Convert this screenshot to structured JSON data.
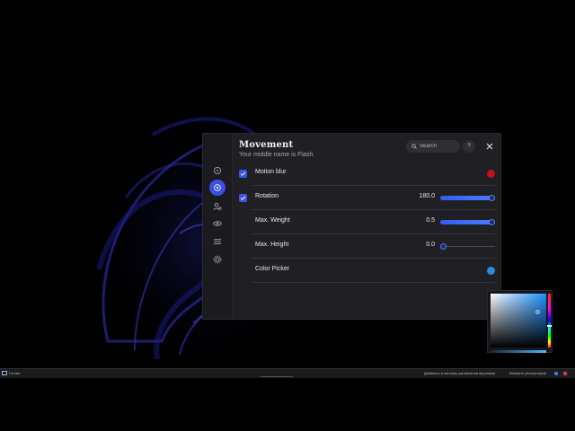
{
  "panel": {
    "title": "Movement",
    "subtitle": "Your middle name is Flash.",
    "search_placeholder": "Search",
    "help_label": "?",
    "rail_icons": [
      "target-icon",
      "movement-icon",
      "user-settings-icon",
      "eye-icon",
      "list-icon",
      "gear-icon"
    ],
    "active_rail_index": 1
  },
  "settings": [
    {
      "label": "Motion blur",
      "kind": "checkbox-color",
      "checked": true,
      "color": "#c8101a"
    },
    {
      "label": "Rotation",
      "kind": "checkbox-slider",
      "checked": true,
      "value": "180.0",
      "fraction": 1.0
    },
    {
      "label": "Max. Weight",
      "kind": "slider",
      "value": "0.5",
      "fraction": 1.0
    },
    {
      "label": "Max. Height",
      "kind": "slider",
      "value": "0.0",
      "fraction": 0.0
    },
    {
      "label": "Color Picker",
      "kind": "color",
      "color": "#2e8ad8"
    }
  ],
  "colors": {
    "accent": "#3b55e6",
    "panel_bg": "#202024",
    "picker_hue": "#1e90ff"
  },
  "taskbar": {
    "app_label": "Готово",
    "tray_item_1": "Добавить в систему управления версиями",
    "tray_item_2": "Выбрать репозиторий"
  }
}
